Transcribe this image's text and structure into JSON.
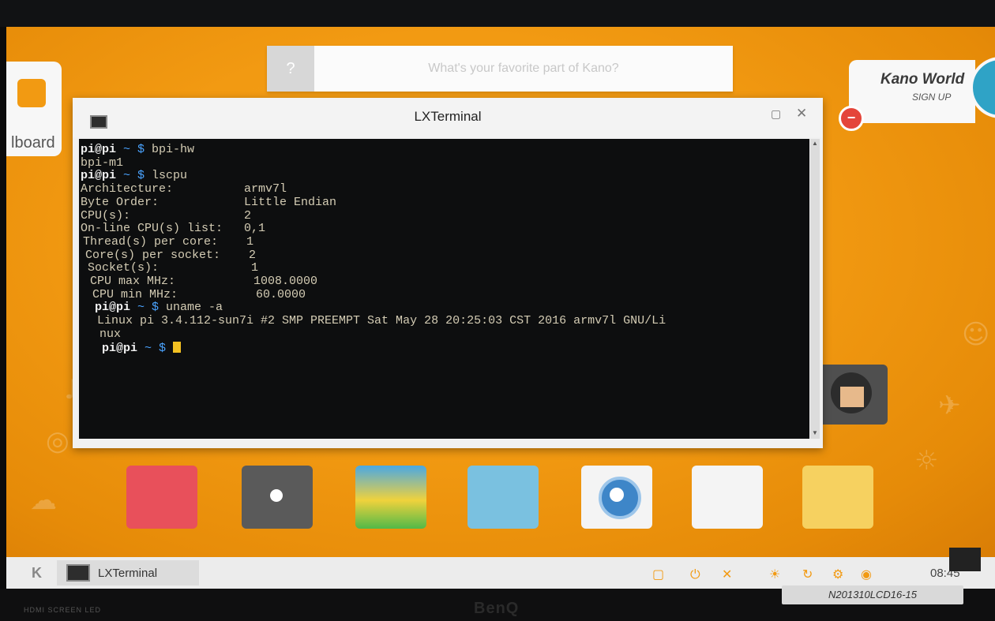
{
  "question_bar": {
    "icon": "?",
    "placeholder": "What's your favorite part of Kano?"
  },
  "dashboard": {
    "label": "lboard"
  },
  "kano_world": {
    "title": "Kano World",
    "subtitle": "SIGN UP"
  },
  "terminal_window": {
    "title": "LXTerminal",
    "lines": [
      {
        "type": "prompt",
        "host": "pi@pi",
        "path": "~",
        "sym": "$",
        "cmd": "bpi-hw"
      },
      {
        "type": "out",
        "text": "bpi-m1"
      },
      {
        "type": "prompt",
        "host": "pi@pi",
        "path": "~",
        "sym": "$",
        "cmd": "lscpu"
      },
      {
        "type": "out",
        "text": "Architecture:          armv7l"
      },
      {
        "type": "out",
        "text": "Byte Order:            Little Endian"
      },
      {
        "type": "out",
        "text": "CPU(s):                2"
      },
      {
        "type": "out",
        "text": "On-line CPU(s) list:   0,1"
      },
      {
        "type": "out",
        "text": "Thread(s) per core:    1"
      },
      {
        "type": "out",
        "text": "Core(s) per socket:    2"
      },
      {
        "type": "out",
        "text": "Socket(s):             1"
      },
      {
        "type": "out",
        "text": "CPU max MHz:           1008.0000"
      },
      {
        "type": "out",
        "text": "CPU min MHz:           60.0000"
      },
      {
        "type": "prompt",
        "host": "pi@pi",
        "path": "~",
        "sym": "$",
        "cmd": "uname -a"
      },
      {
        "type": "out",
        "text": "Linux pi 3.4.112-sun7i #2 SMP PREEMPT Sat May 28 20:25:03 CST 2016 armv7l GNU/Li"
      },
      {
        "type": "out",
        "text": "nux"
      },
      {
        "type": "prompt",
        "host": "pi@pi",
        "path": "~",
        "sym": "$",
        "cmd": ""
      }
    ]
  },
  "taskbar": {
    "logo": "K",
    "window_button": "LXTerminal",
    "clock": "08:45",
    "tray_icons": [
      "window-icon",
      "power-icon",
      "volume-icon",
      "brightness-icon",
      "refresh-icon",
      "settings-icon",
      "wifi-icon"
    ]
  },
  "monitor": {
    "model_label": "N201310LCD16-15",
    "brand": "BenQ",
    "ports": "HDMI  SCREEN  LED"
  },
  "colors": {
    "accent": "#f29a12",
    "terminal_bg": "#0d0e0f",
    "prompt_path": "#4aa3ff",
    "cursor": "#f2c022"
  }
}
